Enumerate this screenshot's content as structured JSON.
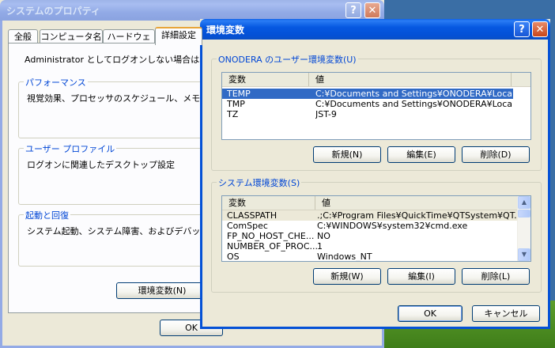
{
  "background_window": {
    "title": "システムのプロパティ",
    "tabs": [
      "全般",
      "コンピュータ名",
      "ハードウェア",
      "詳細設定"
    ],
    "intro_text": "Administrator としてログオンしない場合は、これ",
    "groups": [
      {
        "label": "パフォーマンス",
        "text": "視覚効果、プロセッサのスケジュール、メモリ使用"
      },
      {
        "label": "ユーザー プロファイル",
        "text": "ログオンに関連したデスクトップ設定"
      },
      {
        "label": "起動と回復",
        "text": "システム起動、システム障害、およびデバッグ情"
      }
    ],
    "env_button": "環境変数(N)",
    "ok_button": "OK"
  },
  "dialog": {
    "title": "環境変数",
    "help_glyph": "?",
    "close_glyph": "✕",
    "user_group": {
      "label": "ONODERA のユーザー環境変数(U)",
      "columns": [
        "変数",
        "値"
      ],
      "rows": [
        {
          "var": "TEMP",
          "value": "C:¥Documents and Settings¥ONODERA¥Local..."
        },
        {
          "var": "TMP",
          "value": "C:¥Documents and Settings¥ONODERA¥Local..."
        },
        {
          "var": "TZ",
          "value": "JST-9"
        }
      ],
      "buttons": {
        "new": "新規(N)",
        "edit": "編集(E)",
        "delete": "削除(D)"
      }
    },
    "system_group": {
      "label": "システム環境変数(S)",
      "columns": [
        "変数",
        "値"
      ],
      "rows": [
        {
          "var": "CLASSPATH",
          "value": ".;C:¥Program Files¥QuickTime¥QTSystem¥QT..."
        },
        {
          "var": "ComSpec",
          "value": "C:¥WINDOWS¥system32¥cmd.exe"
        },
        {
          "var": "FP_NO_HOST_CHE...",
          "value": "NO"
        },
        {
          "var": "NUMBER_OF_PROC...",
          "value": "1"
        },
        {
          "var": "OS",
          "value": "Windows_NT"
        }
      ],
      "buttons": {
        "new": "新規(W)",
        "edit": "編集(I)",
        "delete": "削除(L)"
      }
    },
    "ok_button": "OK",
    "cancel_button": "キャンセル"
  },
  "colors": {
    "selection": "#316ac5",
    "titlebar": "#0451d6",
    "group_label": "#0046d5"
  }
}
